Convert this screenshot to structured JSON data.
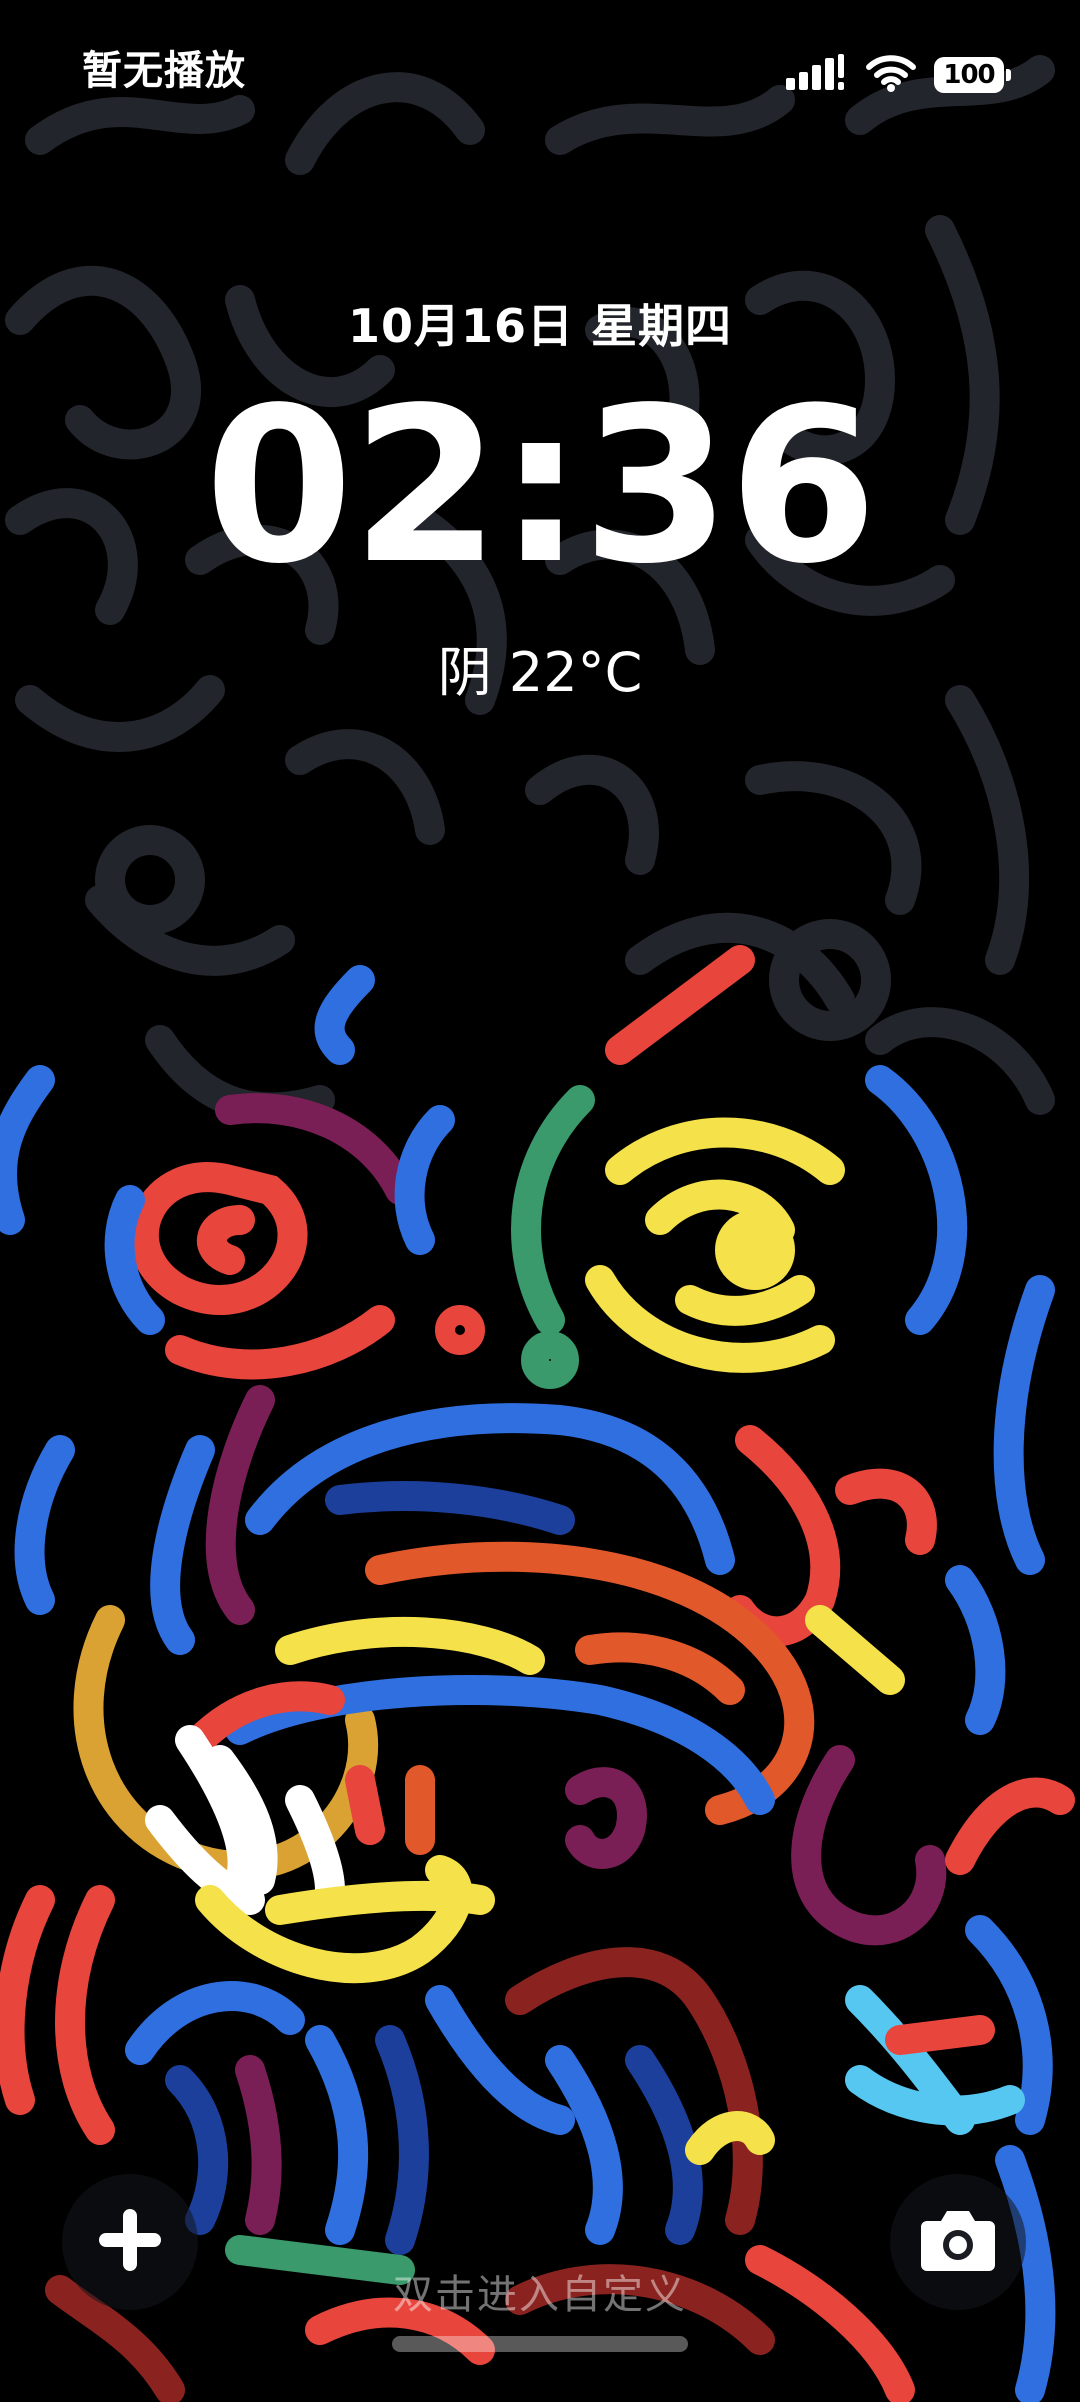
{
  "status_bar": {
    "media_status": "暂无播放",
    "battery_level": "100",
    "signal_icon": "signal-icon",
    "wifi_icon": "wifi-icon",
    "battery_icon": "battery-icon"
  },
  "lockscreen": {
    "date": "10月16日 星期四",
    "time": "02:36",
    "weather": "阴 22°C",
    "hint": "双击进入自定义"
  },
  "shortcuts": {
    "left_icon": "add-icon",
    "right_icon": "camera-icon"
  },
  "colors": {
    "background": "#000000",
    "text": "#ffffff",
    "doodle_dark": "#23262c",
    "red": "#e8453c",
    "blue": "#2f6fe0",
    "yellow": "#f5e14a",
    "green": "#3a9a6b",
    "purple": "#7a1f55",
    "orange": "#e1582b"
  }
}
